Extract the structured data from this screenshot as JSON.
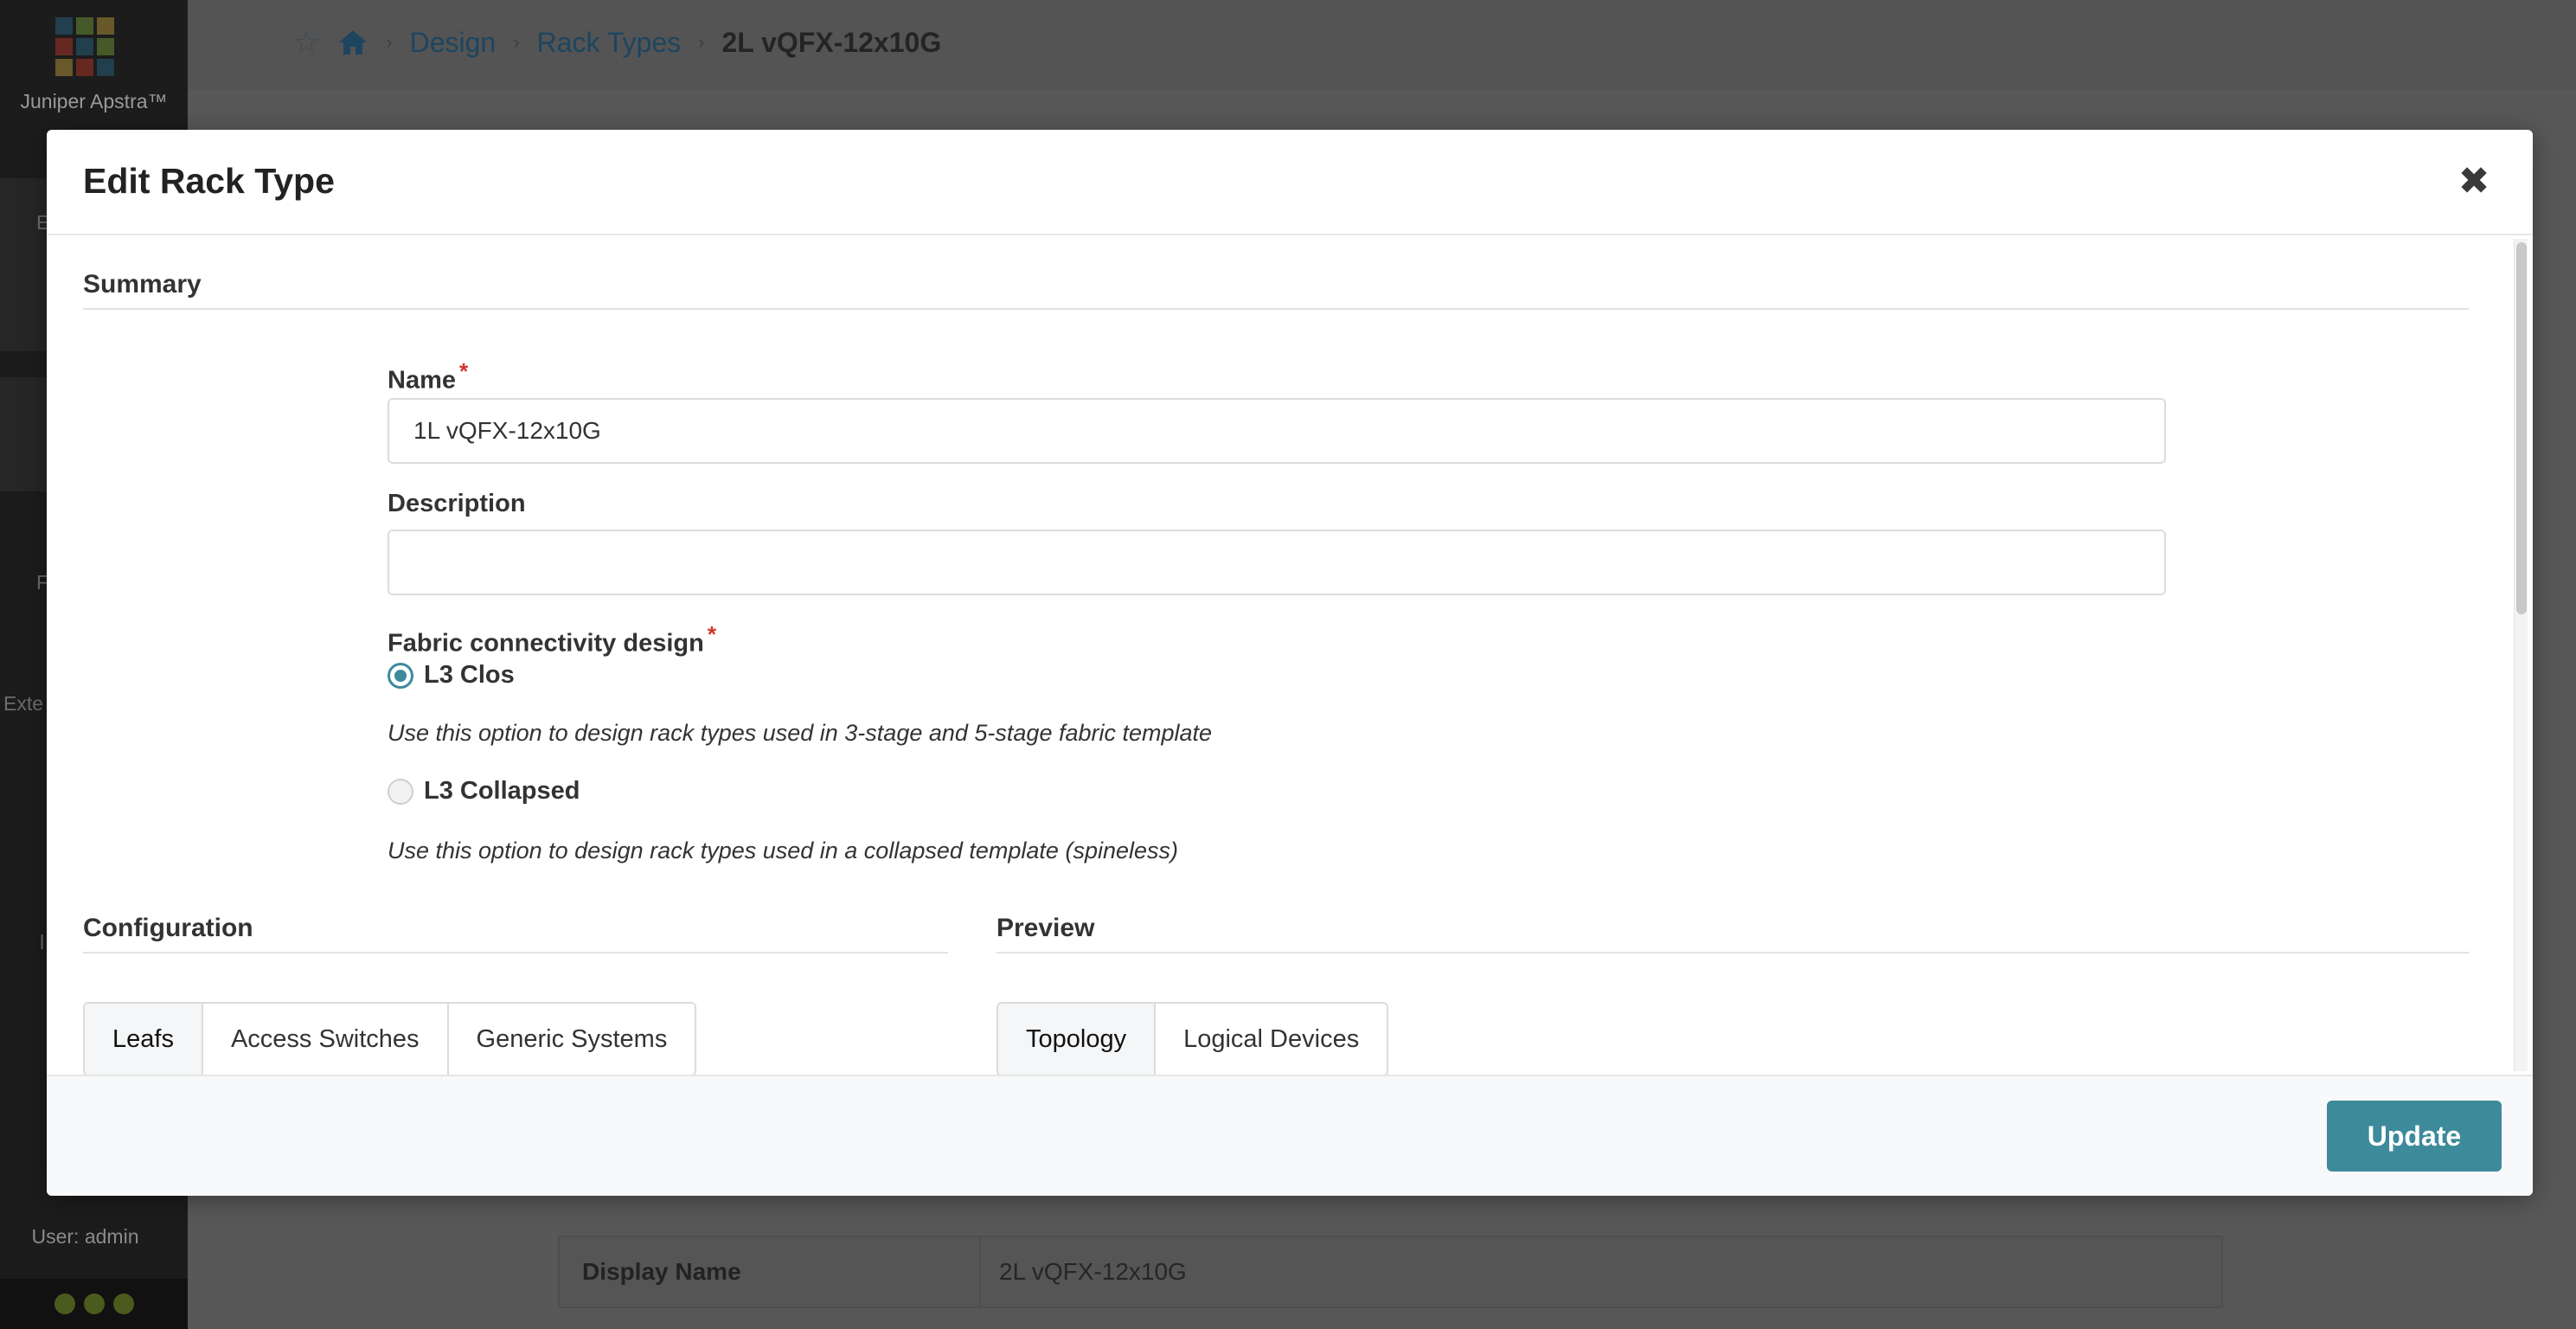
{
  "app": {
    "logo_text": "Juniper Apstra™",
    "sidebar_fragments": [
      "E",
      "F",
      "Exte",
      "l"
    ],
    "user_label": "User: admin",
    "colors": {
      "sidebar": "#1c1c1c",
      "overlay": "#585858"
    }
  },
  "breadcrumb": {
    "items": [
      "Design",
      "Rack Types"
    ],
    "current": "2L vQFX-12x10G"
  },
  "background_table": {
    "label": "Display Name",
    "value": "2L vQFX-12x10G"
  },
  "modal": {
    "title": "Edit Rack Type",
    "summary_heading": "Summary",
    "name": {
      "label": "Name",
      "value": "1L vQFX-12x10G"
    },
    "description": {
      "label": "Description",
      "value": "",
      "placeholder": ""
    },
    "fabric": {
      "label": "Fabric connectivity design",
      "options": [
        {
          "label": "L3 Clos",
          "selected": true,
          "hint": "Use this option to design rack types used in 3-stage and 5-stage fabric template"
        },
        {
          "label": "L3 Collapsed",
          "selected": false,
          "hint": "Use this option to design rack types used in a collapsed template (spineless)"
        }
      ]
    },
    "configuration": {
      "heading": "Configuration",
      "tabs": [
        "Leafs",
        "Access Switches",
        "Generic Systems"
      ],
      "active_tab": "Leafs"
    },
    "preview": {
      "heading": "Preview",
      "tabs": [
        "Topology",
        "Logical Devices"
      ],
      "active_tab": "Topology"
    },
    "update_label": "Update",
    "accent_color": "#3d8a9a"
  }
}
